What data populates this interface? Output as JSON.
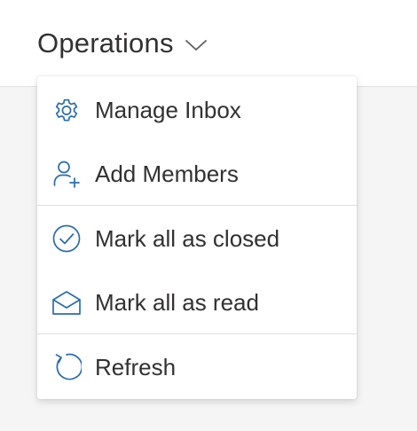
{
  "header": {
    "title": "Operations",
    "chevron_icon": "chevron-down-icon"
  },
  "menu": {
    "items": [
      {
        "label": "Manage Inbox",
        "icon": "gear-icon"
      },
      {
        "label": "Add Members",
        "icon": "add-person-icon"
      },
      {
        "label": "Mark all as closed",
        "icon": "check-circle-icon"
      },
      {
        "label": "Mark all as read",
        "icon": "open-envelope-icon"
      },
      {
        "label": "Refresh",
        "icon": "refresh-icon"
      }
    ]
  },
  "colors": {
    "accent": "#2b6cb0",
    "text": "#323130",
    "background": "#f5f5f5"
  }
}
